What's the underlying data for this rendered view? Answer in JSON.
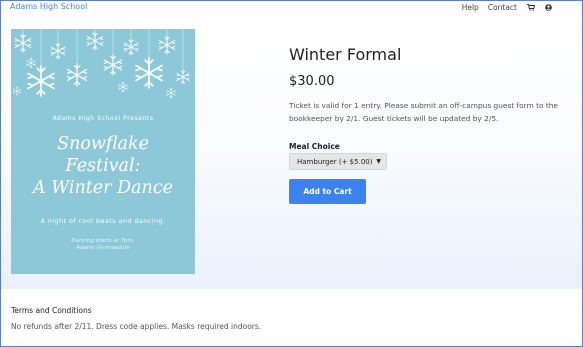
{
  "header": {
    "brand": "Adams High School",
    "nav_links": [
      "Help",
      "Contact"
    ],
    "icons": [
      "cart-icon",
      "user-icon"
    ]
  },
  "poster": {
    "presents": "Adams High School Presents",
    "title_lines": [
      "Snowflake",
      "Festival:",
      "A Winter Dance"
    ],
    "tagline": "A night of cool beats and dancing.",
    "time_lines": [
      "Dancing starts at 7pm,",
      "Adams Gymnasium"
    ]
  },
  "product": {
    "title": "Winter Formal",
    "price": "$30.00",
    "description": "Ticket is valid for 1 entry. Please submit an off-campus guest form to the bookkeeper by 2/1. Guest tickets will be updated by 2/5.",
    "meal_label": "Meal Choice",
    "meal_selected": "Hamburger (+ $5.00)",
    "add_to_cart": "Add to Cart"
  },
  "terms": {
    "title": "Terms and Conditions",
    "text": "No refunds after 2/11. Dress code applies. Masks required indoors."
  },
  "colors": {
    "brand": "#3d86d6",
    "poster_bg": "#8cc8d8",
    "button": "#3d83f0",
    "border": "#5b7fc4"
  }
}
